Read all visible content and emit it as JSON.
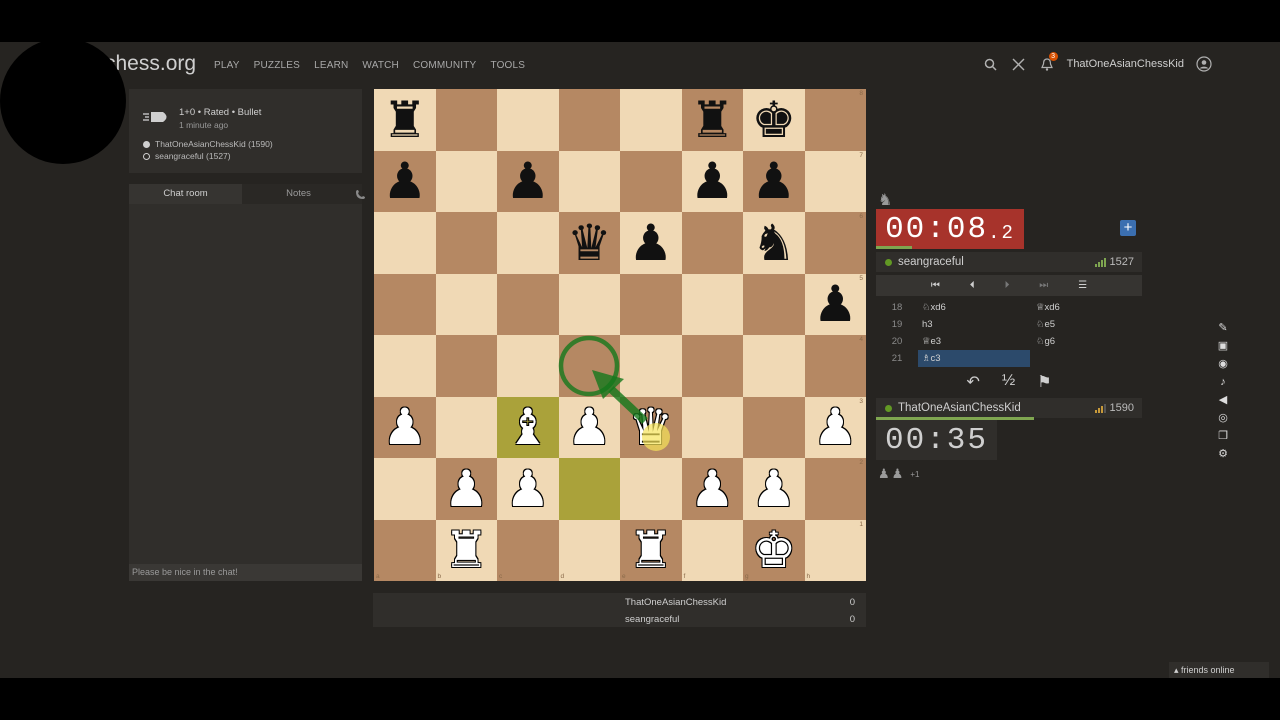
{
  "site": {
    "logo_text": "chess.org"
  },
  "nav": {
    "items": [
      "PLAY",
      "PUZZLES",
      "LEARN",
      "WATCH",
      "COMMUNITY",
      "TOOLS"
    ]
  },
  "header": {
    "username": "ThatOneAsianChessKid",
    "notification_count": "3"
  },
  "game_info": {
    "mode": "1+0 • Rated • Bullet",
    "time_ago": "1 minute ago",
    "white_player": "ThatOneAsianChessKid (1590)",
    "black_player": "seangraceful (1527)"
  },
  "chat": {
    "tab_chat": "Chat room",
    "tab_notes": "Notes",
    "placeholder": "Please be nice in the chat!"
  },
  "board": {
    "ranks": [
      "8",
      "7",
      "6",
      "5",
      "4",
      "3",
      "2",
      "1"
    ],
    "files": [
      "a",
      "b",
      "c",
      "d",
      "e",
      "f",
      "g",
      "h"
    ],
    "position": [
      [
        "r",
        "",
        "",
        "",
        "",
        "r",
        "k",
        ""
      ],
      [
        "p",
        "",
        "p",
        "",
        "",
        "p",
        "p",
        ""
      ],
      [
        "",
        "",
        "",
        "q",
        "p",
        "",
        "n",
        ""
      ],
      [
        "",
        "",
        "",
        "",
        "",
        "",
        "",
        "p"
      ],
      [
        "",
        "",
        "",
        "",
        "",
        "",
        "",
        ""
      ],
      [
        "P",
        "",
        "B",
        "P",
        "Q",
        "",
        "",
        "P"
      ],
      [
        "",
        "P",
        "P",
        "",
        "",
        "P",
        "P",
        ""
      ],
      [
        "",
        "R",
        "",
        "",
        "R",
        "",
        "K",
        ""
      ]
    ],
    "highlighted_squares": [
      "c3",
      "d2"
    ]
  },
  "scoreboard": {
    "players": [
      {
        "name": "ThatOneAsianChessKid",
        "score": "0"
      },
      {
        "name": "seangraceful",
        "score": "0"
      }
    ]
  },
  "opponent": {
    "name": "seangraceful",
    "rating": "1527",
    "clock_main": "00:08",
    "clock_tenths": ".2"
  },
  "player": {
    "name": "ThatOneAsianChessKid",
    "rating": "1590",
    "clock": "00:35"
  },
  "moves": [
    {
      "num": "18",
      "white": "♘xd6",
      "black": "♕xd6"
    },
    {
      "num": "19",
      "white": "h3",
      "black": "♘e5"
    },
    {
      "num": "20",
      "white": "♕e3",
      "black": "♘g6"
    },
    {
      "num": "21",
      "white": "♗c3",
      "black": ""
    }
  ],
  "actions": {
    "takeback": "↶",
    "draw": "½",
    "resign": "⚑"
  },
  "captured": {
    "extra": "+1"
  },
  "footer": {
    "friends": "▴ friends online"
  },
  "colors": {
    "light_square": "#f0d9b5",
    "dark_square": "#b58863",
    "highlight": "#aaa23a",
    "arrow": "#15781b",
    "clock_low": "#a7332b"
  }
}
